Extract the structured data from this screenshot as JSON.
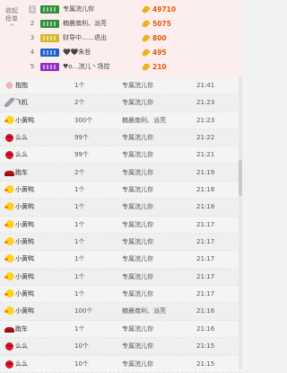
{
  "rank_panel": {
    "collapse_label": "收起榜单",
    "collapse_caret": "^",
    "entries": [
      {
        "rank": "1",
        "name": "专属浣儿你",
        "value": "49710",
        "badge_color": "#2d8f3c"
      },
      {
        "rank": "2",
        "name": "楠晨南利、派亮",
        "value": "5075",
        "badge_color": "#2d8f3c"
      },
      {
        "rank": "3",
        "name": "财导中……退出",
        "value": "800",
        "badge_color": "#d7b928"
      },
      {
        "rank": "4",
        "name": "🖤🖤朱哲",
        "value": "495",
        "badge_color": "#1c61c9"
      },
      {
        "rank": "5",
        "name": "♥o…浣儿丶场控",
        "value": "210",
        "badge_color": "#8f2dc4"
      }
    ]
  },
  "gift_list": [
    {
      "icon": "hug-icon",
      "name": "抱抱",
      "count": "1个",
      "sender": "专属浣儿你",
      "time": "21:41"
    },
    {
      "icon": "plane-icon",
      "name": "飞机",
      "count": "2个",
      "sender": "专属浣儿你",
      "time": "21:23"
    },
    {
      "icon": "duck-icon",
      "name": "小黄鸭",
      "count": "300个",
      "sender": "楠晨南利、派亮",
      "time": "21:23"
    },
    {
      "icon": "lips-icon",
      "name": "么么",
      "count": "99个",
      "sender": "专属浣儿你",
      "time": "21:22"
    },
    {
      "icon": "lips-icon",
      "name": "么么",
      "count": "99个",
      "sender": "专属浣儿你",
      "time": "21:21"
    },
    {
      "icon": "car-icon",
      "name": "跑车",
      "count": "2个",
      "sender": "专属浣儿你",
      "time": "21:19"
    },
    {
      "icon": "duck-icon",
      "name": "小黄鸭",
      "count": "1个",
      "sender": "专属浣儿你",
      "time": "21:18"
    },
    {
      "icon": "duck-icon",
      "name": "小黄鸭",
      "count": "1个",
      "sender": "专属浣儿你",
      "time": "21:18"
    },
    {
      "icon": "duck-icon",
      "name": "小黄鸭",
      "count": "1个",
      "sender": "专属浣儿你",
      "time": "21:17"
    },
    {
      "icon": "duck-icon",
      "name": "小黄鸭",
      "count": "1个",
      "sender": "专属浣儿你",
      "time": "21:17"
    },
    {
      "icon": "duck-icon",
      "name": "小黄鸭",
      "count": "1个",
      "sender": "专属浣儿你",
      "time": "21:17"
    },
    {
      "icon": "duck-icon",
      "name": "小黄鸭",
      "count": "1个",
      "sender": "专属浣儿你",
      "time": "21:17"
    },
    {
      "icon": "duck-icon",
      "name": "小黄鸭",
      "count": "1个",
      "sender": "专属浣儿你",
      "time": "21:17"
    },
    {
      "icon": "duck-icon",
      "name": "小黄鸭",
      "count": "100个",
      "sender": "楠晨南利、派亮",
      "time": "21:16"
    },
    {
      "icon": "car-icon",
      "name": "跑车",
      "count": "1个",
      "sender": "专属浣儿你",
      "time": "21:16"
    },
    {
      "icon": "lips-icon",
      "name": "么么",
      "count": "10个",
      "sender": "专属浣儿你",
      "time": "21:15"
    },
    {
      "icon": "lips-icon",
      "name": "么么",
      "count": "10个",
      "sender": "专属浣儿你",
      "time": "21:15"
    }
  ],
  "colors": {
    "coin": "#f5b71a",
    "value_text": "#e25a06",
    "panel_bg": "#fdeeee"
  }
}
